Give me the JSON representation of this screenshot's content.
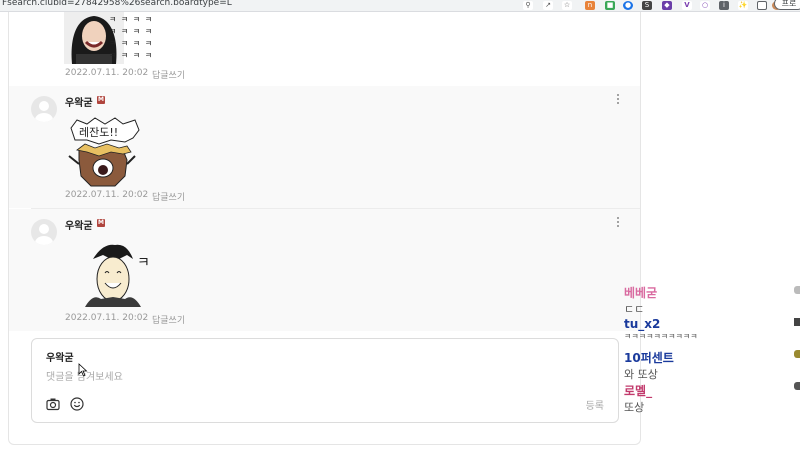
{
  "browser": {
    "url_fragment": "Fsearch.clubid=27842958%26search.boardtype=L",
    "profile_label": "프로",
    "extensions": [
      "zoom-icon",
      "share-icon",
      "star-icon",
      "ext1",
      "ext2",
      "ext3",
      "ext4",
      "ext5",
      "V",
      "ext6",
      "ext7",
      "puzzle-icon",
      "ext8",
      "ext9",
      "avatar-icon"
    ]
  },
  "comments": [
    {
      "nick": "",
      "badge": "",
      "sticker_text": "ㅋㅋㅋㅋ",
      "date": "2022.07.11. 20:02",
      "reply": "답글쓰기"
    },
    {
      "nick": "우왁굳",
      "badge": "M",
      "sticker_text": "레잔도!!",
      "date": "2022.07.11. 20:02",
      "reply": "답글쓰기"
    },
    {
      "nick": "우왁굳",
      "badge": "M",
      "sticker_text": "ㅋ",
      "date": "2022.07.11. 20:02",
      "reply": "답글쓰기"
    }
  ],
  "writebox": {
    "nick": "우왁굳",
    "placeholder": "댓글을 남겨보세요",
    "submit_label": "등록"
  },
  "chat": [
    {
      "name": "베베굳",
      "msg": "ㄷㄷ",
      "color": "#d96aa0"
    },
    {
      "name": "tu_x2",
      "msg": "ㅋㅋㅋㅋㅋㅋㅋㅋㅋㅋ",
      "color": "#1a3a9c"
    },
    {
      "name": "10퍼센트",
      "msg": "와 또상",
      "color": "#1a3a9c"
    },
    {
      "name": "로멜_",
      "msg": "또상",
      "color": "#c23a6c"
    }
  ],
  "colors": {
    "badge": "#b0453e",
    "comment_bg": "#f9f9f9"
  }
}
